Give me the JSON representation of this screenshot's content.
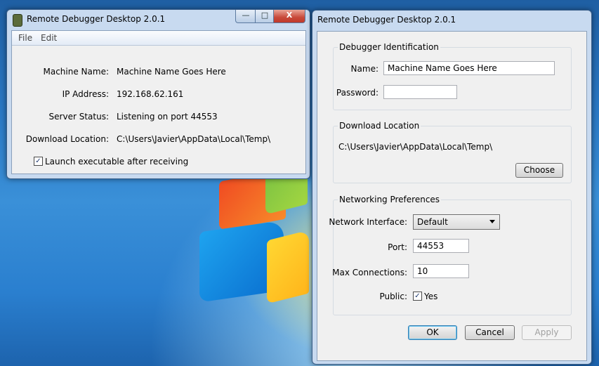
{
  "main_window": {
    "title": "Remote Debugger Desktop 2.0.1",
    "controls": {
      "minimize": "—",
      "maximize": "□",
      "close": "X"
    },
    "menu": [
      "File",
      "Edit"
    ],
    "info": {
      "machine_name_label": "Machine Name:",
      "machine_name_value": "Machine Name Goes Here",
      "ip_label": "IP Address:",
      "ip_value": "192.168.62.161",
      "status_label": "Server Status:",
      "status_value": "Listening on port 44553",
      "download_label": "Download Location:",
      "download_value": "C:\\Users\\Javier\\AppData\\Local\\Temp\\"
    },
    "launch_checkbox": {
      "label": "Launch executable after receiving",
      "checked": true,
      "mark": "✓"
    }
  },
  "prefs_window": {
    "title": "Remote Debugger Desktop 2.0.1",
    "identification": {
      "group_title": "Debugger Identification",
      "name_label": "Name:",
      "name_value": "Machine Name Goes Here",
      "password_label": "Password:",
      "password_value": ""
    },
    "download": {
      "group_title": "Download Location",
      "path": "C:\\Users\\Javier\\AppData\\Local\\Temp\\",
      "choose_button": "Choose"
    },
    "networking": {
      "group_title": "Networking Preferences",
      "interface_label": "Network Interface:",
      "interface_value": "Default",
      "port_label": "Port:",
      "port_value": "44553",
      "max_label": "Max Connections:",
      "max_value": "10",
      "public_label": "Public:",
      "public_checkbox_label": "Yes",
      "public_checked": true,
      "mark": "✓"
    },
    "buttons": {
      "ok": "OK",
      "cancel": "Cancel",
      "apply": "Apply"
    }
  }
}
